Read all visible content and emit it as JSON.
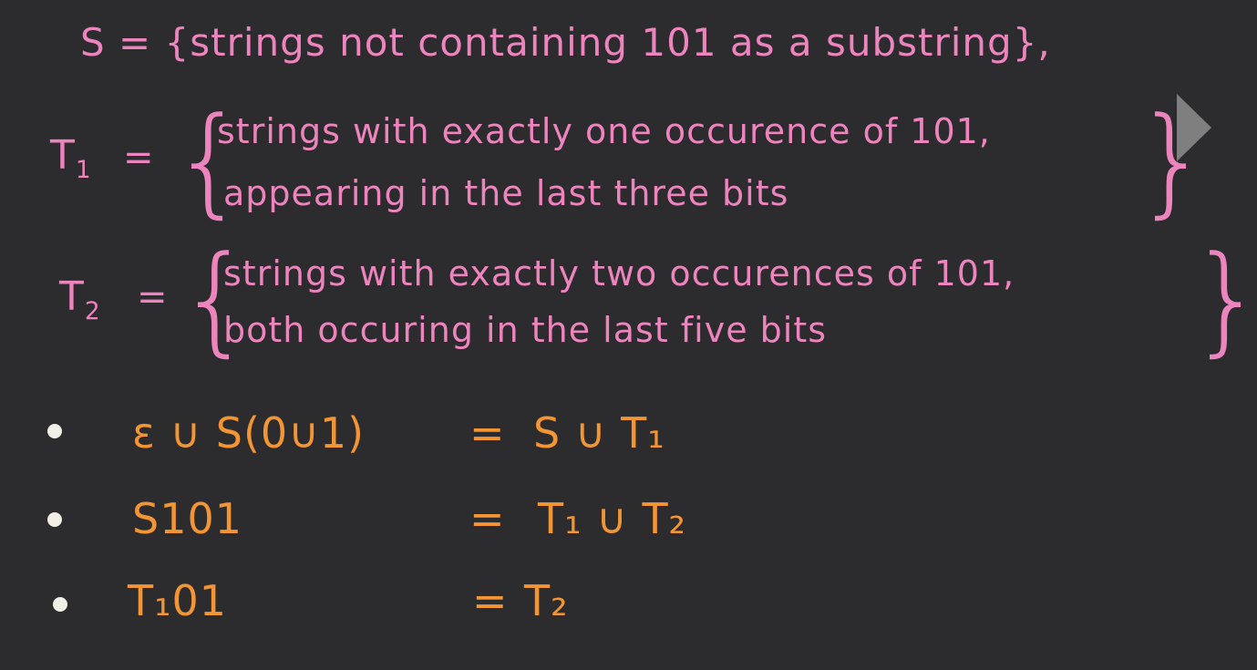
{
  "definitions": {
    "s_line": "S = {strings not containing 101 as a substring},",
    "t1_label": "T",
    "t1_sub": "1",
    "t1_line1": "strings with exactly one occurence of 101,",
    "t1_line2": "appearing in the last three bits",
    "t2_label": "T",
    "t2_sub": "2",
    "t2_line1": "strings with exactly two occurences of 101,",
    "t2_line2": "both occuring in the last five bits",
    "eq": "=",
    "lbrace": "{",
    "rbrace": "}"
  },
  "equations": [
    {
      "lhs": "ε ∪ S(0∪1)",
      "eq": "=",
      "rhs": "S ∪ T₁"
    },
    {
      "lhs": "S101",
      "eq": "=",
      "rhs": "T₁ ∪ T₂"
    },
    {
      "lhs": "T₁01",
      "eq": "=",
      "rhs": "T₂"
    }
  ],
  "colors": {
    "background": "#2c2b2d",
    "definitions": "#ec84bd",
    "equations": "#f29534",
    "play": "#7f7f7f"
  },
  "icons": {
    "play": "play-triangle-icon"
  }
}
